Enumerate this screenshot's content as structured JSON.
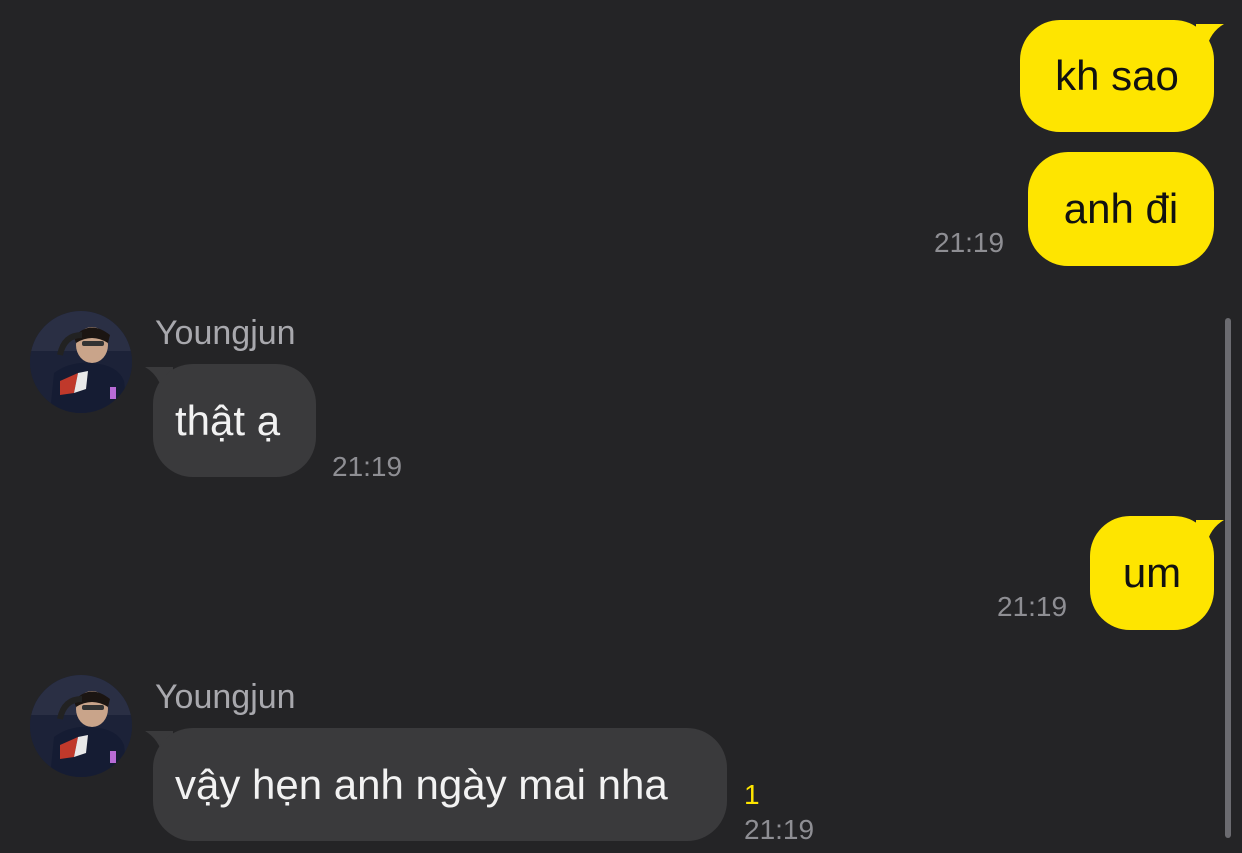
{
  "messages": [
    {
      "id": "m1",
      "direction": "out",
      "text": "kh sao",
      "time": ""
    },
    {
      "id": "m2",
      "direction": "out",
      "text": "anh đi",
      "time": "21:19"
    },
    {
      "id": "m3",
      "direction": "in",
      "sender": "Youngjun",
      "text": "thật ạ",
      "time": "21:19"
    },
    {
      "id": "m4",
      "direction": "out",
      "text": "um",
      "time": "21:19"
    },
    {
      "id": "m5",
      "direction": "in",
      "sender": "Youngjun",
      "text": "vậy hẹn anh ngày mai nha",
      "time": "21:19",
      "unread_count": "1"
    }
  ],
  "colors": {
    "background": "#242426",
    "outgoing_bubble": "#FEE500",
    "incoming_bubble": "#3A3A3C",
    "timestamp": "#8E8E93",
    "unread_badge": "#FEE500"
  },
  "icons": {
    "avatar": "user-avatar-photo"
  }
}
